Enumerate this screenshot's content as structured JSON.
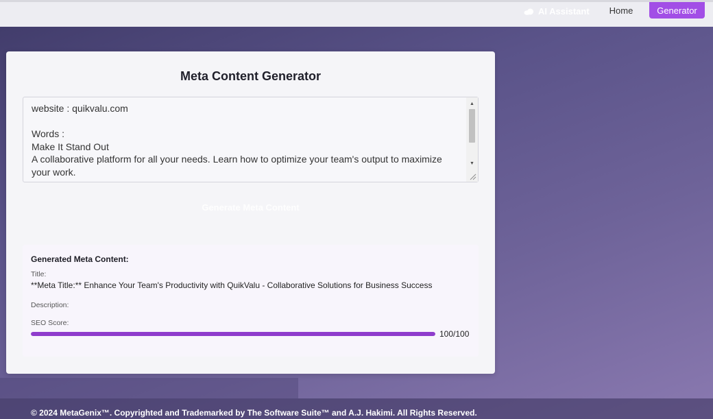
{
  "nav": {
    "brand_label": "AI Assistant",
    "brand_icon": "cloud-icon",
    "home_label": "Home",
    "generator_label": "Generator",
    "accent_color": "#a24ee6"
  },
  "main": {
    "title": "Meta Content Generator",
    "input_value": "website : quikvalu.com\n\nWords :\nMake It Stand Out\nA collaborative platform for all your needs. Learn how to optimize your team's output to maximize your work.",
    "generate_label": "Generate Meta Content"
  },
  "result": {
    "heading": "Generated Meta Content:",
    "title_label": "Title:",
    "title_value": "**Meta Title:** Enhance Your Team's Productivity with QuikValu - Collaborative Solutions for Business Success",
    "description_label": "Description:",
    "seo_label": "SEO Score:",
    "seo_score": 100,
    "seo_max": 100,
    "seo_text": "100/100",
    "seo_color": "#8f3ccc"
  },
  "footer": {
    "text": "© 2024 MetaGenix™. Copyrighted and Trademarked by The Software Suite™ and A.J. Hakimi. All Rights Reserved."
  }
}
